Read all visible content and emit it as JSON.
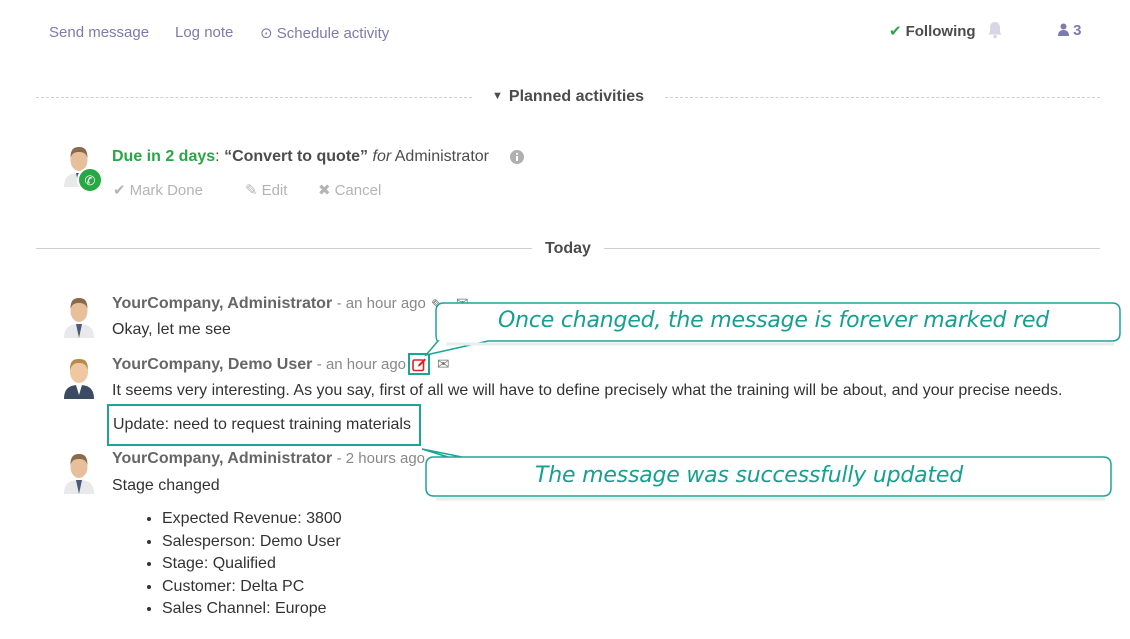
{
  "topbar": {
    "send_message": "Send message",
    "log_note": "Log note",
    "schedule_activity": "Schedule activity",
    "following": "Following",
    "followers_count": "3"
  },
  "planned": {
    "title": "Planned activities",
    "activity": {
      "due": "Due in 2 days",
      "colon": ":",
      "title": "“Convert to quote”",
      "for": "for",
      "assignee": "Administrator"
    },
    "actions": {
      "mark_done": "Mark Done",
      "edit": "Edit",
      "cancel": "Cancel"
    }
  },
  "today_label": "Today",
  "messages": [
    {
      "author": "YourCompany, Administrator",
      "ago": "- an hour ago",
      "body": "Okay, let me see"
    },
    {
      "author": "YourCompany, Demo User",
      "ago": "- an hour ago",
      "body": "It seems very interesting. As you say, first of all we will have to define precisely what the training will be about, and your precise needs.",
      "update": "Update: need to request training materials"
    },
    {
      "author": "YourCompany, Administrator",
      "ago": "- 2 hours ago",
      "body": "Stage changed",
      "changes": [
        "Expected Revenue: 3800",
        "Salesperson: Demo User",
        "Stage: Qualified",
        "Customer: Delta PC",
        "Sales Channel: Europe"
      ]
    }
  ],
  "callouts": {
    "marked_red": "Once changed, the message is forever marked red",
    "updated": "The message was successfully updated"
  },
  "colors": {
    "link": "#7c7bad",
    "success": "#28a745",
    "callout": "#16a08f",
    "edited_icon": "#e02020"
  },
  "icons": [
    "clock-icon",
    "check-icon",
    "bell-icon",
    "user-icon",
    "caret-down-icon",
    "phone-icon",
    "info-icon",
    "pencil-icon",
    "times-icon",
    "edit-square-icon",
    "envelope-icon"
  ]
}
